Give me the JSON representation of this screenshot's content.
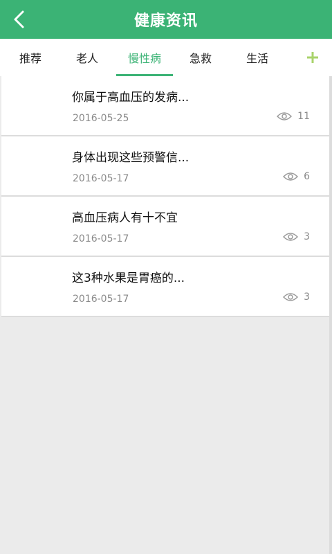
{
  "header": {
    "title": "健康资讯"
  },
  "tabs": [
    "推荐",
    "老人",
    "慢性病",
    "急救",
    "生活"
  ],
  "accent_color": "#3bb375",
  "articles": [
    {
      "title": "你属于高血压的发病...",
      "date": "2016-05-25",
      "views": "11"
    },
    {
      "title": "身体出现这些预警信...",
      "date": "2016-05-17",
      "views": "6"
    },
    {
      "title": "高血压病人有十不宜",
      "date": "2016-05-17",
      "views": "3"
    },
    {
      "title": "这3种水果是胃癌的...",
      "date": "2016-05-17",
      "views": "3"
    }
  ]
}
